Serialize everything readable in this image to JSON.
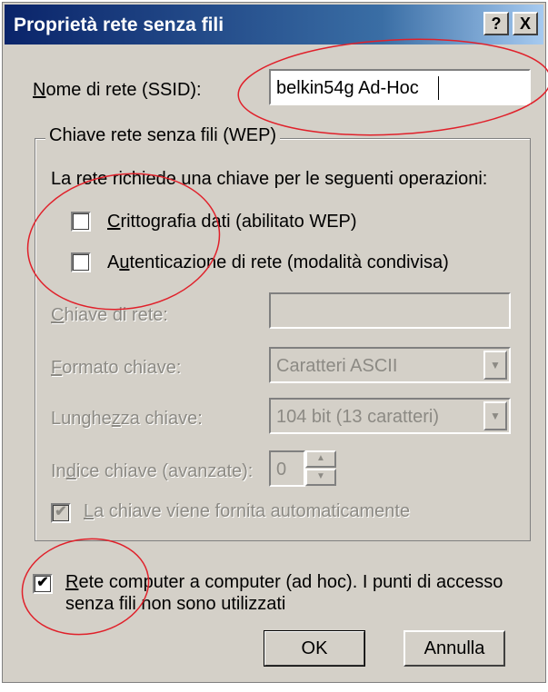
{
  "title": "Proprietà rete senza fili",
  "title_buttons": {
    "help": "?",
    "close": "X"
  },
  "ssid": {
    "label_ul": "N",
    "label_rest": "ome di rete (SSID):",
    "value": "belkin54g Ad-Hoc"
  },
  "wep_group": {
    "label": "Chiave rete senza fili (WEP)",
    "description": "La rete richiede una chiave per le seguenti operazioni:",
    "encryption": {
      "ul": "C",
      "rest": "rittografia dati (abilitato WEP)",
      "checked": false
    },
    "auth": {
      "pre": "A",
      "ul": "u",
      "rest": "tenticazione di rete (modalità condivisa)",
      "checked": false
    },
    "network_key": {
      "ul": "C",
      "rest": "hiave di rete:",
      "value": ""
    },
    "key_format": {
      "ul": "F",
      "rest": "ormato chiave:",
      "value": "Caratteri ASCII"
    },
    "key_length": {
      "pre": "Lunghe",
      "ul": "z",
      "rest": "za chiave:",
      "value": "104 bit (13 caratteri)"
    },
    "key_index": {
      "pre": "In",
      "ul": "d",
      "rest": "ice chiave (avanzate):",
      "value": "0"
    },
    "auto_key": {
      "ul": "L",
      "rest": "a chiave viene fornita automaticamente",
      "checked": true
    }
  },
  "adhoc": {
    "ul": "R",
    "line1_rest": "ete computer a computer (ad hoc). I punti di accesso",
    "line2": "senza fili non sono utilizzati",
    "checked": true
  },
  "buttons": {
    "ok": "OK",
    "cancel": "Annulla"
  },
  "check_mark": "✔",
  "colors": {
    "annotation": "#e0202a",
    "titlebar": "#0a246a",
    "face": "#d4d0c8"
  }
}
